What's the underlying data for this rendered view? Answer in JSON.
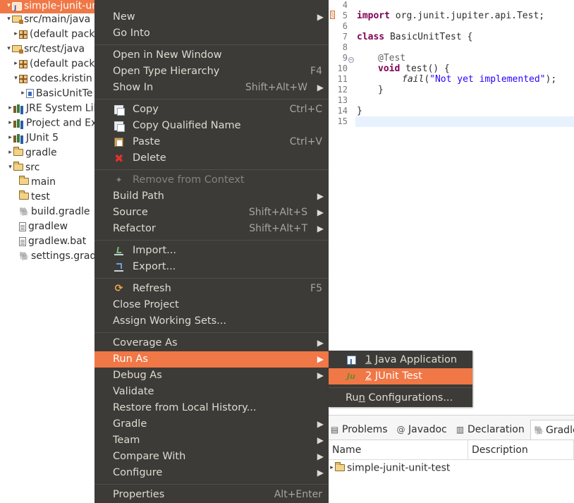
{
  "tree": {
    "rows": [
      {
        "label": "simple-junit-unit-test",
        "icon": "project-icon",
        "arrow": "open"
      },
      {
        "label": "src/main/java",
        "icon": "source-folder-icon",
        "arrow": "open"
      },
      {
        "label": "(default pack",
        "icon": "package-icon",
        "arrow": "closed"
      },
      {
        "label": "src/test/java",
        "icon": "source-folder-icon",
        "arrow": "open"
      },
      {
        "label": "(default pack",
        "icon": "package-icon",
        "arrow": "closed"
      },
      {
        "label": "codes.kristin",
        "icon": "package-icon",
        "arrow": "open"
      },
      {
        "label": "BasicUnitTe",
        "icon": "java-file-icon",
        "arrow": "closed"
      },
      {
        "label": "JRE System Lib",
        "icon": "library-icon",
        "arrow": "closed"
      },
      {
        "label": "Project and Ex",
        "icon": "library-icon",
        "arrow": "closed"
      },
      {
        "label": "JUnit 5",
        "icon": "library-icon",
        "arrow": "closed"
      },
      {
        "label": "gradle",
        "icon": "folder-icon",
        "arrow": "closed"
      },
      {
        "label": "src",
        "icon": "folder-icon",
        "arrow": "open"
      },
      {
        "label": "main",
        "icon": "folder-icon",
        "arrow": "none"
      },
      {
        "label": "test",
        "icon": "folder-icon",
        "arrow": "none"
      },
      {
        "label": "build.gradle",
        "icon": "gradle-file-icon",
        "arrow": "none"
      },
      {
        "label": "gradlew",
        "icon": "text-file-icon",
        "arrow": "none"
      },
      {
        "label": "gradlew.bat",
        "icon": "text-file-icon",
        "arrow": "none"
      },
      {
        "label": "settings.gradle",
        "icon": "gradle-file-icon",
        "arrow": "none"
      }
    ]
  },
  "editor": {
    "line_numbers": [
      "4",
      "5",
      "6",
      "7",
      "8",
      "9",
      "10",
      "11",
      "12",
      "13",
      "14",
      "15"
    ],
    "code": {
      "l5_kw": "import",
      "l5_rest": " org.junit.jupiter.api.Test;",
      "l7_kw": "class",
      "l7_rest": " BasicUnitTest {",
      "l9_ann": "@Test",
      "l10_kw": "void",
      "l10_rest": " test() {",
      "l11_method": "fail",
      "l11_open": "(",
      "l11_str": "\"Not yet implemented\"",
      "l11_close": ");",
      "l12": "}",
      "l14": "}"
    }
  },
  "menu": {
    "new": "New",
    "go_into": "Go Into",
    "open_new_window": "Open in New Window",
    "open_type_hierarchy": "Open Type Hierarchy",
    "open_type_hierarchy_acc": "F4",
    "show_in": "Show In",
    "show_in_acc": "Shift+Alt+W",
    "copy": "Copy",
    "copy_acc": "Ctrl+C",
    "copy_qualified": "Copy Qualified Name",
    "paste": "Paste",
    "paste_acc": "Ctrl+V",
    "delete": "Delete",
    "remove_context": "Remove from Context",
    "build_path": "Build Path",
    "source": "Source",
    "source_acc": "Shift+Alt+S",
    "refactor": "Refactor",
    "refactor_acc": "Shift+Alt+T",
    "import": "Import...",
    "export": "Export...",
    "refresh": "Refresh",
    "refresh_acc": "F5",
    "close_project": "Close Project",
    "assign_working_sets": "Assign Working Sets...",
    "coverage_as": "Coverage As",
    "run_as": "Run As",
    "debug_as": "Debug As",
    "validate": "Validate",
    "restore_history": "Restore from Local History...",
    "gradle": "Gradle",
    "team": "Team",
    "compare_with": "Compare With",
    "configure": "Configure",
    "properties": "Properties",
    "properties_acc": "Alt+Enter"
  },
  "submenu": {
    "java_app_num": "1",
    "java_app_label": " Java Application",
    "junit_num": "2",
    "junit_label": " JUnit Test",
    "run_config_a": "Ru",
    "run_config_u": "n",
    "run_config_b": " Configurations..."
  },
  "views": {
    "tabs": [
      "Problems",
      "Javadoc",
      "Declaration",
      "Gradle"
    ],
    "columns": [
      "Name",
      "Description"
    ],
    "row_label": "simple-junit-unit-test"
  },
  "colors": {
    "accent": "#f07746",
    "menu_bg": "#3c3b37",
    "menu_text": "#dfdbd2",
    "keyword": "#7f0055",
    "string": "#2a00ff"
  }
}
